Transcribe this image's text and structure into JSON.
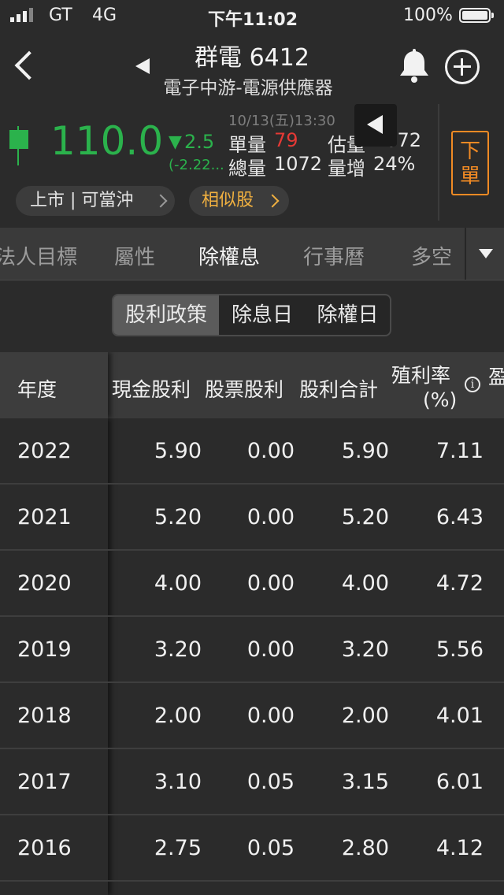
{
  "status_bar": {
    "carrier": "GT",
    "network": "4G",
    "time": "下午11:02",
    "battery": "100%"
  },
  "header": {
    "title": "群電 6412",
    "industry": "電子中游-電源供應器"
  },
  "quote": {
    "price": "110.0",
    "change_arrow": "▼",
    "change": "2.5",
    "change_pct": "(-2.22...",
    "timestamp": "10/13(五)13:30",
    "single_vol_label": "單量",
    "single_vol_value": "79",
    "est_vol_label": "估量",
    "est_vol_value": "1072",
    "total_vol_label": "總量",
    "total_vol_value": "1072",
    "vol_increase_label": "量增",
    "vol_increase_value": "24%",
    "order_button": "下\n單"
  },
  "pills": {
    "market": "上市 | 可當沖",
    "similar": "相似股"
  },
  "tabs": [
    "法人目標",
    "屬性",
    "除權息",
    "行事曆",
    "多空"
  ],
  "active_tab": "除權息",
  "segmented": [
    "股利政策",
    "除息日",
    "除權日"
  ],
  "table": {
    "headers": {
      "year": "年度",
      "cash": "現金股利",
      "stock": "股票股利",
      "total": "股利合計",
      "yield_line1": "殖利率",
      "yield_line2": "(%)",
      "next": "盈"
    },
    "rows": [
      {
        "year": "2022",
        "cash": "5.90",
        "stock": "0.00",
        "total": "5.90",
        "yield": "7.11"
      },
      {
        "year": "2021",
        "cash": "5.20",
        "stock": "0.00",
        "total": "5.20",
        "yield": "6.43"
      },
      {
        "year": "2020",
        "cash": "4.00",
        "stock": "0.00",
        "total": "4.00",
        "yield": "4.72"
      },
      {
        "year": "2019",
        "cash": "3.20",
        "stock": "0.00",
        "total": "3.20",
        "yield": "5.56"
      },
      {
        "year": "2018",
        "cash": "2.00",
        "stock": "0.00",
        "total": "2.00",
        "yield": "4.01"
      },
      {
        "year": "2017",
        "cash": "3.10",
        "stock": "0.05",
        "total": "3.15",
        "yield": "6.01"
      },
      {
        "year": "2016",
        "cash": "2.75",
        "stock": "0.05",
        "total": "2.80",
        "yield": "4.12"
      }
    ]
  },
  "colors": {
    "down": "#2bb24c",
    "up": "#e53935",
    "accent": "#f08a24",
    "similar": "#f0b040"
  }
}
